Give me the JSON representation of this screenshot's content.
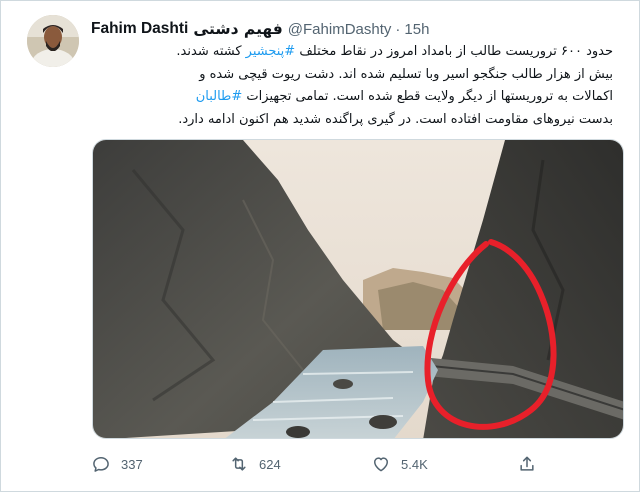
{
  "author": {
    "name": "Fahim Dashti",
    "name_fa": "فهیم دشتی",
    "handle": "@FahimDashty",
    "separator": "·",
    "time": "15h"
  },
  "tweet": {
    "line1_before": "حدود ۶۰۰ تروریست طالب از بامداد امروز در نقاط مختلف ",
    "line1_hashtag": "#پنجشیر",
    "line1_after": " کشته شدند.",
    "line2": "بیش از هزار طالب جنگجو اسیر وبا تسلیم شده اند. دشت ریوت قیچی شده و",
    "line3_before": "اکمالات به تروریستها از دیگر ولایت قطع شده است. تمامی تجهیزات ",
    "line3_hashtag": "#طالبان",
    "line4": "بدست نیروهای مقاومت افتاده است. در گیری پراگنده شدید هم اکنون ادامه دارد."
  },
  "stats": {
    "replies": "337",
    "retweets": "624",
    "likes": "5.4K"
  },
  "colors": {
    "accent": "#1d9bf0",
    "secondary_text": "#536471",
    "annotation_circle": "#e8202a"
  },
  "icons": {
    "reply": "reply-icon",
    "retweet": "retweet-icon",
    "like": "heart-icon",
    "share": "share-icon",
    "more": "more-dots-icon"
  }
}
